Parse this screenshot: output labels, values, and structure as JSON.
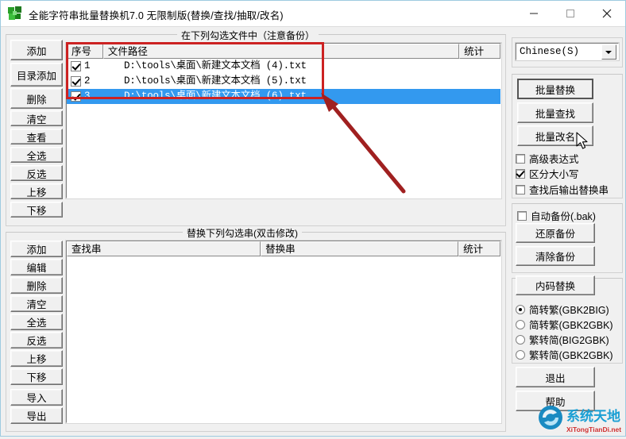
{
  "window": {
    "title": "全能字符串批量替换机7.0 无限制版(替换/查找/抽取/改名)",
    "icon": "app-puzzle-icon",
    "minimize": "—",
    "maximize": "□",
    "close": "✕",
    "accent_border": "#9ecbe0"
  },
  "file_panel": {
    "legend": "在下列勾选文件中（注意备份）",
    "columns": [
      "序号",
      "文件路径",
      "统计"
    ],
    "buttons": [
      "添加",
      "目录添加",
      "删除",
      "清空",
      "查看",
      "全选",
      "反选",
      "上移",
      "下移"
    ],
    "rows": [
      {
        "checked": true,
        "index": "1",
        "path": "D:\\tools\\桌面\\新建文本文档 (4).txt",
        "count": "",
        "selected": false
      },
      {
        "checked": true,
        "index": "2",
        "path": "D:\\tools\\桌面\\新建文本文档 (5).txt",
        "count": "",
        "selected": false
      },
      {
        "checked": true,
        "index": "3",
        "path": "D:\\tools\\桌面\\新建文本文档 (6).txt",
        "count": "",
        "selected": true
      }
    ],
    "selection_color": "#3399ef"
  },
  "replace_panel": {
    "legend": "替换下列勾选串(双击修改)",
    "columns": [
      "查找串",
      "替换串",
      "统计"
    ],
    "buttons": [
      "添加",
      "编辑",
      "删除",
      "清空",
      "全选",
      "反选",
      "上移",
      "下移",
      "导入",
      "导出"
    ],
    "rows": []
  },
  "right_panel": {
    "encoding": {
      "value": "Chinese(S)",
      "arrow": "chevron-down-icon"
    },
    "actions": [
      {
        "label": "批量替换",
        "default": true
      },
      {
        "label": "批量查找",
        "default": false
      },
      {
        "label": "批量改名",
        "default": false
      }
    ],
    "options": [
      {
        "label": "高级表达式",
        "checked": false
      },
      {
        "label": "区分大小写",
        "checked": true
      },
      {
        "label": "查找后输出替换串",
        "checked": false
      }
    ],
    "backup": {
      "auto_label": "自动备份(.bak)",
      "auto_checked": false,
      "restore_label": "还原备份",
      "clear_label": "清除备份"
    },
    "encoding_convert": {
      "button": "内码替换",
      "radios": [
        {
          "label": "简转繁(GBK2BIG)",
          "checked": true
        },
        {
          "label": "简转繁(GBK2GBK)",
          "checked": false
        },
        {
          "label": "繁转简(BIG2GBK)",
          "checked": false
        },
        {
          "label": "繁转简(GBK2GBK)",
          "checked": false
        }
      ]
    },
    "exit_label": "退出",
    "help_label": "帮助"
  },
  "annotations": {
    "highlight_color": "#c22",
    "arrow_color": "#a02020"
  },
  "watermark": {
    "title": "系统天地",
    "url": "XiTongTianDi.net",
    "color": "#1a9fd4"
  }
}
